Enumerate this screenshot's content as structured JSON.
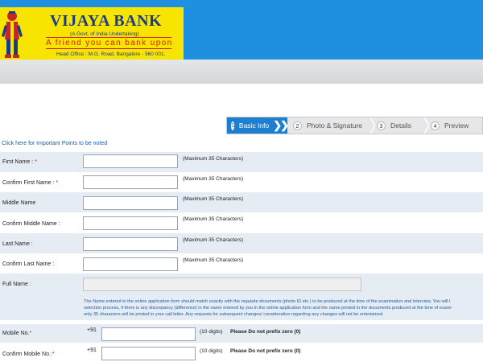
{
  "header": {
    "bank_name": "VIJAYA BANK",
    "bank_subtitle": "(A Govt. of India Undertaking)",
    "tagline": "A friend you can bank upon",
    "address": "Head Office : M.G. Road, Bangalore - 560 001.",
    "brand_yellow": "#f7e400",
    "brand_blue": "#1e90df",
    "brand_red": "#d0201e"
  },
  "steps": [
    {
      "num": "1",
      "label": "Basic Info",
      "active": true
    },
    {
      "num": "2",
      "label": "Photo & Signature",
      "active": false
    },
    {
      "num": "3",
      "label": "Details",
      "active": false
    },
    {
      "num": "4",
      "label": "Preview",
      "active": false
    }
  ],
  "important_link": "Click here for Important Points to be noted",
  "form": {
    "first_name": {
      "label": "First Name :",
      "required": "*",
      "value": "",
      "hint": "(Maximum 35 Characters)"
    },
    "confirm_first_name": {
      "label": "Confirm First Name :",
      "required": "*",
      "value": "",
      "hint": "(Maximum 35 Characters)"
    },
    "middle_name": {
      "label": "Middle Name",
      "value": "",
      "hint": "(Maximum 35 Characters)"
    },
    "confirm_middle_name": {
      "label": "Confirm Middle Name :",
      "value": "",
      "hint": "(Maximum 35 Characters)"
    },
    "last_name": {
      "label": "Last Name :",
      "value": "",
      "hint": "(Maximum 35 Characters)"
    },
    "confirm_last_name": {
      "label": "Confirm Last Name :",
      "value": "",
      "hint": "(Maximum 35 Characters)"
    },
    "full_name": {
      "label": "Full Name :",
      "value": ""
    },
    "name_note": [
      "The Name entered in the online application form should match exactly with the requisite documents (photo ID etc.) to be produced at the time of the examination and interview. You will l",
      "selection process, if there is any discrepancy (difference) in the name entered by you in the online application form and the name printed in the documents produced at the time of exami",
      "only 35 characters will be printed in your call letter. Any requests for subsequent changes/ consideration regarding any changes will not be entertained."
    ],
    "mobile": {
      "label": "Mobile No.",
      "required": "*",
      "prefix": "+91",
      "value": "",
      "digits": "(10 digits)",
      "note": "Please Do not prefix zero (0)"
    },
    "confirm_mobile": {
      "label": "Confirm Mobile No.:",
      "required": "*",
      "prefix": "+91",
      "value": "",
      "digits": "(10 digits)",
      "note": "Please Do not prefix zero (0)"
    }
  }
}
